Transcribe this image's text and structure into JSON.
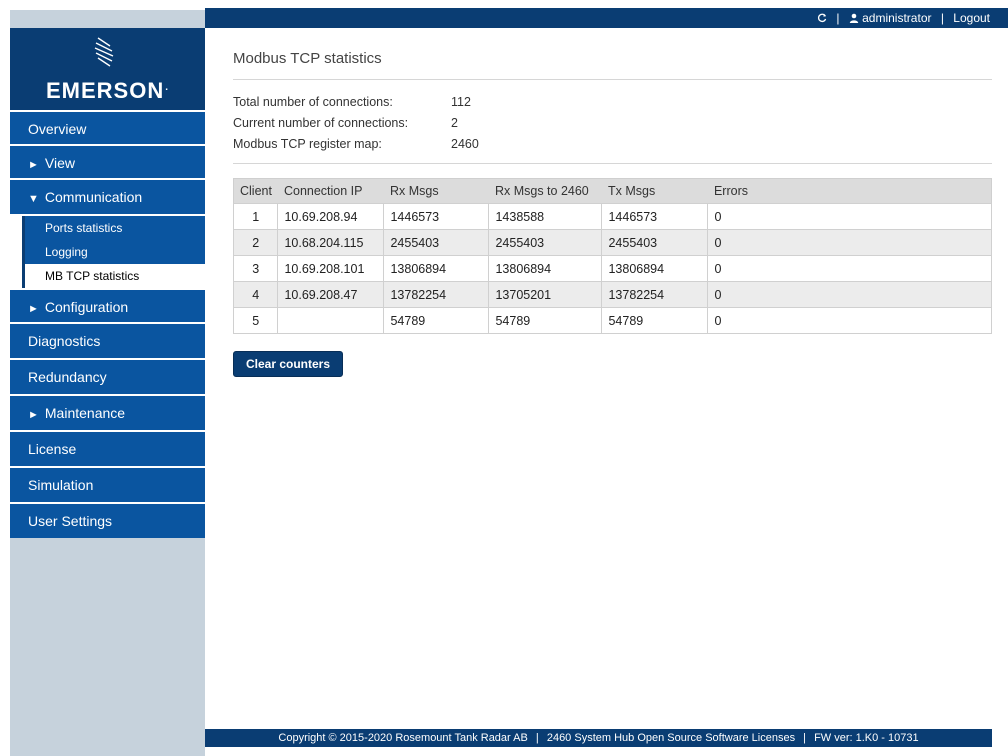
{
  "topbar": {
    "refresh_icon": "refresh-icon",
    "user_icon": "user-icon",
    "username": "administrator",
    "separator": "|",
    "logout_label": "Logout"
  },
  "brand": {
    "name": "EMERSON",
    "dot": "."
  },
  "nav": {
    "overview": "Overview",
    "view": "View",
    "communication": "Communication",
    "sub": {
      "ports": "Ports statistics",
      "logging": "Logging",
      "mbtcp": "MB TCP statistics"
    },
    "configuration": "Configuration",
    "diagnostics": "Diagnostics",
    "redundancy": "Redundancy",
    "maintenance": "Maintenance",
    "license": "License",
    "simulation": "Simulation",
    "user_settings": "User Settings"
  },
  "page": {
    "title": "Modbus TCP statistics",
    "summary": {
      "total_label": "Total number of connections:",
      "total_value": "112",
      "current_label": "Current number of connections:",
      "current_value": "2",
      "map_label": "Modbus TCP register map:",
      "map_value": "2460"
    },
    "table": {
      "headers": [
        "Client",
        "Connection IP",
        "Rx Msgs",
        "Rx Msgs to 2460",
        "Tx Msgs",
        "Errors"
      ],
      "rows": [
        [
          "1",
          "10.69.208.94",
          "1446573",
          "1438588",
          "1446573",
          "0"
        ],
        [
          "2",
          "10.68.204.115",
          "2455403",
          "2455403",
          "2455403",
          "0"
        ],
        [
          "3",
          "10.69.208.101",
          "13806894",
          "13806894",
          "13806894",
          "0"
        ],
        [
          "4",
          "10.69.208.47",
          "13782254",
          "13705201",
          "13782254",
          "0"
        ],
        [
          "5",
          "",
          "54789",
          "54789",
          "54789",
          "0"
        ]
      ]
    },
    "clear_button": "Clear counters"
  },
  "footer": {
    "copyright": "Copyright © 2015-2020 Rosemount Tank Radar AB",
    "sep": "|",
    "oss": "2460 System Hub Open Source Software Licenses",
    "fw": "FW ver: 1.K0 - 10731"
  }
}
